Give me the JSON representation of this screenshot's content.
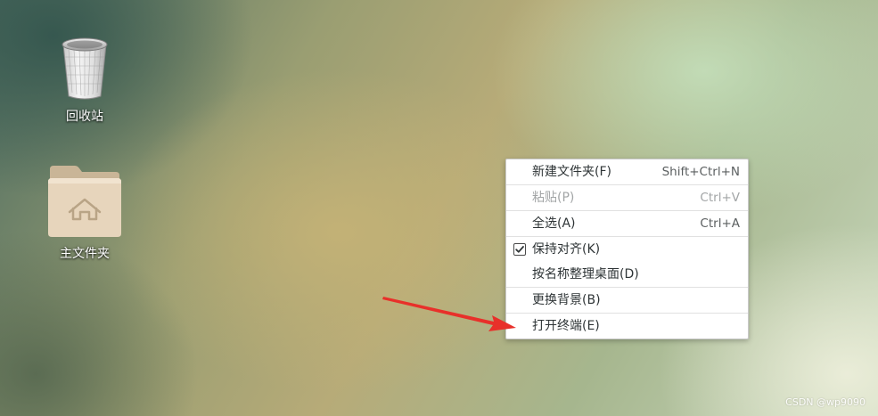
{
  "desktop": {
    "icons": [
      {
        "label": "回收站",
        "icon": "trash-icon"
      },
      {
        "label": "主文件夹",
        "icon": "home-folder-icon"
      }
    ]
  },
  "context_menu": {
    "items": [
      {
        "label": "新建文件夹(F)",
        "shortcut": "Shift+Ctrl+N",
        "enabled": true
      },
      {
        "label": "粘贴(P)",
        "shortcut": "Ctrl+V",
        "enabled": false
      },
      {
        "label": "全选(A)",
        "shortcut": "Ctrl+A",
        "enabled": true
      },
      {
        "label": "保持对齐(K)",
        "shortcut": "",
        "enabled": true,
        "checked": true
      },
      {
        "label": "按名称整理桌面(D)",
        "shortcut": "",
        "enabled": true
      },
      {
        "label": "更换背景(B)",
        "shortcut": "",
        "enabled": true
      },
      {
        "label": "打开终端(E)",
        "shortcut": "",
        "enabled": true
      }
    ]
  },
  "annotation": {
    "arrow_color": "#e8302a",
    "points_to": "打开终端(E)"
  },
  "watermark": "CSDN @wp9090"
}
